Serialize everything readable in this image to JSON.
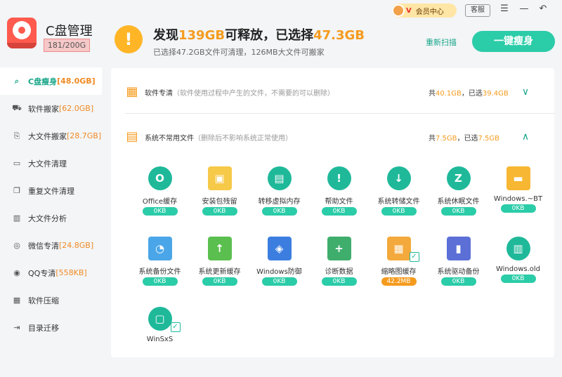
{
  "app": {
    "title": "C盘管理",
    "capacity": "181/200G"
  },
  "nav": [
    {
      "label": "C盘瘦身",
      "extra": "[48.0GB]",
      "icon": "search-icon"
    },
    {
      "label": "软件搬家",
      "extra": "[62.0GB]",
      "icon": "truck-icon"
    },
    {
      "label": "大文件搬家",
      "extra": "[28.7GB]",
      "icon": "file-move-icon"
    },
    {
      "label": "大文件清理",
      "extra": "",
      "icon": "folder-icon"
    },
    {
      "label": "重复文件清理",
      "extra": "",
      "icon": "duplicate-icon"
    },
    {
      "label": "大文件分析",
      "extra": "",
      "icon": "chart-icon"
    },
    {
      "label": "微信专清",
      "extra": "[24.8GB]",
      "icon": "wechat-icon"
    },
    {
      "label": "QQ专清",
      "extra": "[558KB]",
      "icon": "qq-icon"
    },
    {
      "label": "软件压缩",
      "extra": "",
      "icon": "compress-icon"
    },
    {
      "label": "目录迁移",
      "extra": "",
      "icon": "migrate-icon"
    }
  ],
  "topbar": {
    "vip_badge": "V",
    "vip_label": "会员中心",
    "service_label": "客服",
    "headline_a": "发现",
    "headline_found": "139GB",
    "headline_b": "可释放，已选择",
    "headline_selected": "47.3GB",
    "subline": "已选择47.2GB文件可清理，126MB大文件可搬家",
    "rescan_label": "重新扫描",
    "slim_label": "一键瘦身"
  },
  "sections": {
    "software": {
      "title": "软件专清",
      "desc": "（软件使用过程中产生的文件，不需要的可以删除）",
      "total_prefix": "共",
      "total": "40.1GB",
      "selected_prefix": "，已选",
      "selected": "39.4GB"
    },
    "uncommon": {
      "title": "系统不常用文件",
      "desc": "（删除后不影响系统正常使用）",
      "total_prefix": "共",
      "total": "7.5GB",
      "selected_prefix": "，已选",
      "selected": "7.5GB"
    }
  },
  "items": [
    {
      "label": "Office缓存",
      "size": "0KB",
      "icon": "office-icon",
      "glyph": "O",
      "color": "#1fb99a"
    },
    {
      "label": "安装包残留",
      "size": "0KB",
      "icon": "package-icon",
      "glyph": "▣",
      "color": "#f7c948"
    },
    {
      "label": "转移虚拟内存",
      "size": "0KB",
      "icon": "save-icon",
      "glyph": "▤",
      "color": "#1fb99a"
    },
    {
      "label": "帮助文件",
      "size": "0KB",
      "icon": "help-icon",
      "glyph": "!",
      "color": "#1fb99a"
    },
    {
      "label": "系统转储文件",
      "size": "0KB",
      "icon": "download-icon",
      "glyph": "↓",
      "color": "#1fb99a"
    },
    {
      "label": "系统休眠文件",
      "size": "0KB",
      "icon": "sleep-icon",
      "glyph": "Z",
      "color": "#1fb99a"
    },
    {
      "label": "Windows.~BT",
      "size": "0KB",
      "icon": "folder-icon",
      "glyph": "▬",
      "color": "#f7b733"
    },
    {
      "label": "系统备份文件",
      "size": "0KB",
      "icon": "clock-icon",
      "glyph": "◔",
      "color": "#4aa6e8"
    },
    {
      "label": "系统更新缓存",
      "size": "0KB",
      "icon": "update-icon",
      "glyph": "↑",
      "color": "#5bbf4f"
    },
    {
      "label": "Windows防御",
      "size": "0KB",
      "icon": "shield-icon",
      "glyph": "◈",
      "color": "#3c7ee0"
    },
    {
      "label": "诊断数据",
      "size": "0KB",
      "icon": "diagnostic-icon",
      "glyph": "+",
      "color": "#3fae6d"
    },
    {
      "label": "缩略图缓存",
      "size": "42.2MB",
      "icon": "thumbnail-icon",
      "glyph": "▦",
      "color": "#f4a93c"
    },
    {
      "label": "系统驱动备份",
      "size": "0KB",
      "icon": "driver-icon",
      "glyph": "▮",
      "color": "#5b6fd6"
    },
    {
      "label": "Windows.old",
      "size": "0KB",
      "icon": "window-icon",
      "glyph": "▥",
      "color": "#1fb99a"
    },
    {
      "label": "WinSxS",
      "size": "",
      "icon": "winsxs-icon",
      "glyph": "▢",
      "color": "#1fb99a"
    }
  ]
}
